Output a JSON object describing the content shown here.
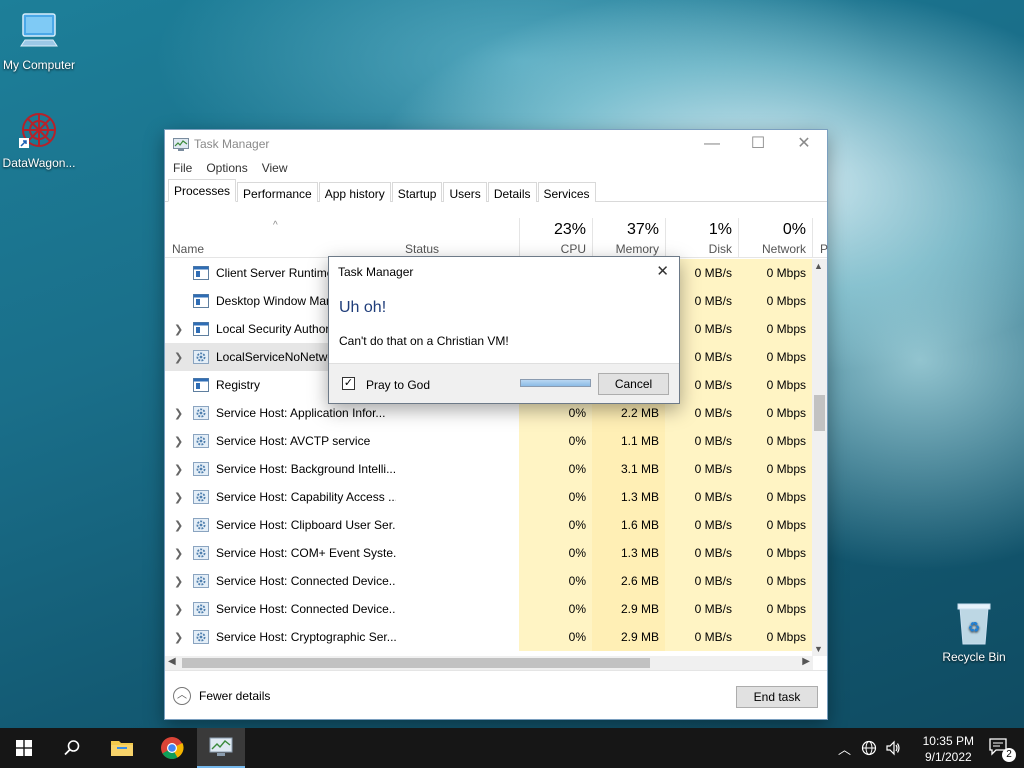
{
  "desktop": {
    "icons": [
      {
        "label": "My Computer"
      },
      {
        "label": "DataWagon..."
      },
      {
        "label": "Recycle Bin"
      }
    ]
  },
  "task_manager": {
    "title": "Task Manager",
    "menu": [
      "File",
      "Options",
      "View"
    ],
    "tabs": [
      "Processes",
      "Performance",
      "App history",
      "Startup",
      "Users",
      "Details",
      "Services"
    ],
    "active_tab": "Processes",
    "columns": {
      "name": "Name",
      "status": "Status",
      "cpu": {
        "pct": "23%",
        "label": "CPU"
      },
      "memory": {
        "pct": "37%",
        "label": "Memory"
      },
      "disk": {
        "pct": "1%",
        "label": "Disk"
      },
      "network": {
        "pct": "0%",
        "label": "Network"
      },
      "power_partial": "P"
    },
    "rows": [
      {
        "name": "Client Server Runtime Process",
        "expand": false,
        "cpu": "",
        "mem": "",
        "disk": "0 MB/s",
        "net": "0 Mbps"
      },
      {
        "name": "Desktop Window Manager",
        "expand": false,
        "cpu": "",
        "mem": "",
        "disk": "0 MB/s",
        "net": "0 Mbps"
      },
      {
        "name": "Local Security Authority",
        "expand": true,
        "cpu": "",
        "mem": "",
        "disk": "0 MB/s",
        "net": "0 Mbps"
      },
      {
        "name": "LocalServiceNoNetwork",
        "expand": true,
        "cpu": "",
        "mem": "",
        "disk": "0 MB/s",
        "net": "0 Mbps",
        "selected": true
      },
      {
        "name": "Registry",
        "expand": false,
        "cpu": "",
        "mem": "",
        "disk": "0 MB/s",
        "net": "0 Mbps"
      },
      {
        "name": "Service Host: Application Infor...",
        "expand": true,
        "cpu": "0%",
        "mem": "2.2 MB",
        "disk": "0 MB/s",
        "net": "0 Mbps"
      },
      {
        "name": "Service Host: AVCTP service",
        "expand": true,
        "cpu": "0%",
        "mem": "1.1 MB",
        "disk": "0 MB/s",
        "net": "0 Mbps"
      },
      {
        "name": "Service Host: Background Intelli...",
        "expand": true,
        "cpu": "0%",
        "mem": "3.1 MB",
        "disk": "0 MB/s",
        "net": "0 Mbps"
      },
      {
        "name": "Service Host: Capability Access ...",
        "expand": true,
        "cpu": "0%",
        "mem": "1.3 MB",
        "disk": "0 MB/s",
        "net": "0 Mbps"
      },
      {
        "name": "Service Host: Clipboard User Ser...",
        "expand": true,
        "cpu": "0%",
        "mem": "1.6 MB",
        "disk": "0 MB/s",
        "net": "0 Mbps"
      },
      {
        "name": "Service Host: COM+ Event Syste...",
        "expand": true,
        "cpu": "0%",
        "mem": "1.3 MB",
        "disk": "0 MB/s",
        "net": "0 Mbps"
      },
      {
        "name": "Service Host: Connected Device...",
        "expand": true,
        "cpu": "0%",
        "mem": "2.6 MB",
        "disk": "0 MB/s",
        "net": "0 Mbps"
      },
      {
        "name": "Service Host: Connected Device...",
        "expand": true,
        "cpu": "0%",
        "mem": "2.9 MB",
        "disk": "0 MB/s",
        "net": "0 Mbps"
      },
      {
        "name": "Service Host: Cryptographic Ser...",
        "expand": true,
        "cpu": "0%",
        "mem": "2.9 MB",
        "disk": "0 MB/s",
        "net": "0 Mbps"
      }
    ],
    "footer": {
      "fewer_details": "Fewer details",
      "end_task": "End task"
    }
  },
  "dialog": {
    "title": "Task Manager",
    "heading": "Uh oh!",
    "message": "Can't do that on a Christian VM!",
    "checkbox_label": "Pray to God",
    "checkbox_checked": true,
    "cancel": "Cancel"
  },
  "taskbar": {
    "time": "10:35 PM",
    "date": "9/1/2022",
    "notification_count": "2"
  }
}
